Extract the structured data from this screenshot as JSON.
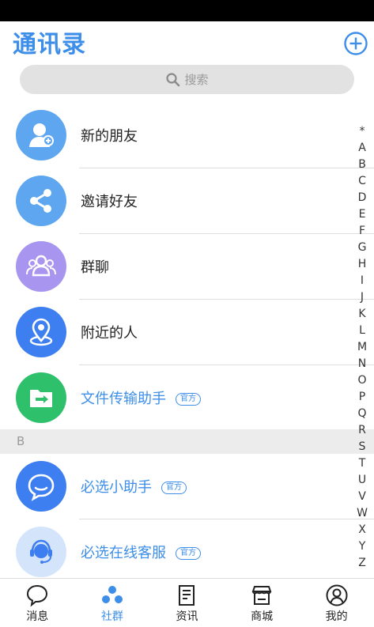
{
  "header": {
    "title": "通讯录"
  },
  "search": {
    "placeholder": "搜索"
  },
  "contacts": [
    {
      "label": "新的朋友",
      "icon": "new-friend-icon",
      "color": "#5ea7f0"
    },
    {
      "label": "邀请好友",
      "icon": "share-icon",
      "color": "#5ea7f0"
    },
    {
      "label": "群聊",
      "icon": "group-icon",
      "color": "#a895f0"
    },
    {
      "label": "附近的人",
      "icon": "location-pin-icon",
      "color": "#3d7ef0"
    },
    {
      "label": "文件传输助手",
      "badge": "官方",
      "icon": "folder-transfer-icon",
      "color": "#2ec06a"
    }
  ],
  "section_b": {
    "letter": "B",
    "items": [
      {
        "label": "必选小助手",
        "badge": "官方",
        "icon": "chat-bubble-icon",
        "color": "#3d7ef0"
      },
      {
        "label": "必选在线客服",
        "badge": "官方",
        "icon": "headset-agent-icon",
        "color": "#d4e5fb"
      }
    ]
  },
  "index_letters": [
    "*",
    "A",
    "B",
    "C",
    "D",
    "E",
    "F",
    "G",
    "H",
    "I",
    "J",
    "K",
    "L",
    "M",
    "N",
    "O",
    "P",
    "Q",
    "R",
    "S",
    "T",
    "U",
    "V",
    "W",
    "X",
    "Y",
    "Z"
  ],
  "tabbar": {
    "tabs": [
      {
        "label": "消息",
        "icon": "message-icon",
        "active": false
      },
      {
        "label": "社群",
        "icon": "community-icon",
        "active": true
      },
      {
        "label": "资讯",
        "icon": "news-icon",
        "active": false
      },
      {
        "label": "商城",
        "icon": "store-icon",
        "active": false
      },
      {
        "label": "我的",
        "icon": "profile-icon",
        "active": false
      }
    ]
  },
  "colors": {
    "accent": "#3d8ee8"
  }
}
